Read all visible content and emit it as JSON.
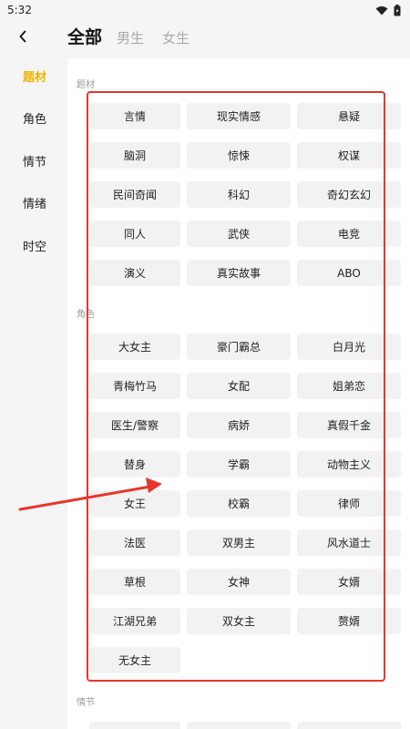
{
  "status_bar": {
    "time": "5:32",
    "icons": [
      "wifi-icon",
      "battery-icon"
    ]
  },
  "header": {
    "back_icon": "chevron-left-icon",
    "tabs": [
      {
        "label": "全部",
        "active": true
      },
      {
        "label": "男生",
        "active": false
      },
      {
        "label": "女生",
        "active": false
      }
    ]
  },
  "sidebar": {
    "items": [
      {
        "label": "题材",
        "active": true
      },
      {
        "label": "角色",
        "active": false
      },
      {
        "label": "情节",
        "active": false
      },
      {
        "label": "情绪",
        "active": false
      },
      {
        "label": "时空",
        "active": false
      }
    ]
  },
  "sections": {
    "theme": {
      "title": "题材",
      "tags": [
        "言情",
        "现实情感",
        "悬疑",
        "脑洞",
        "惊悚",
        "权谋",
        "民间奇闻",
        "科幻",
        "奇幻玄幻",
        "同人",
        "武侠",
        "电竞",
        "演义",
        "真实故事",
        "ABO"
      ]
    },
    "role": {
      "title": "角色",
      "tags": [
        "大女主",
        "豪门霸总",
        "白月光",
        "青梅竹马",
        "女配",
        "姐弟恋",
        "医生/警察",
        "病娇",
        "真假千金",
        "替身",
        "学霸",
        "动物主义",
        "女王",
        "校霸",
        "律师",
        "法医",
        "双男主",
        "风水道士",
        "草根",
        "女神",
        "女婿",
        "江湖兄弟",
        "双女主",
        "赘婿",
        "无女主"
      ]
    },
    "plot": {
      "title": "情节"
    }
  },
  "colors": {
    "accent": "#f0b400",
    "annotation": "#e5372c",
    "chip_bg": "#f2f2f2",
    "muted_text": "#999999"
  }
}
